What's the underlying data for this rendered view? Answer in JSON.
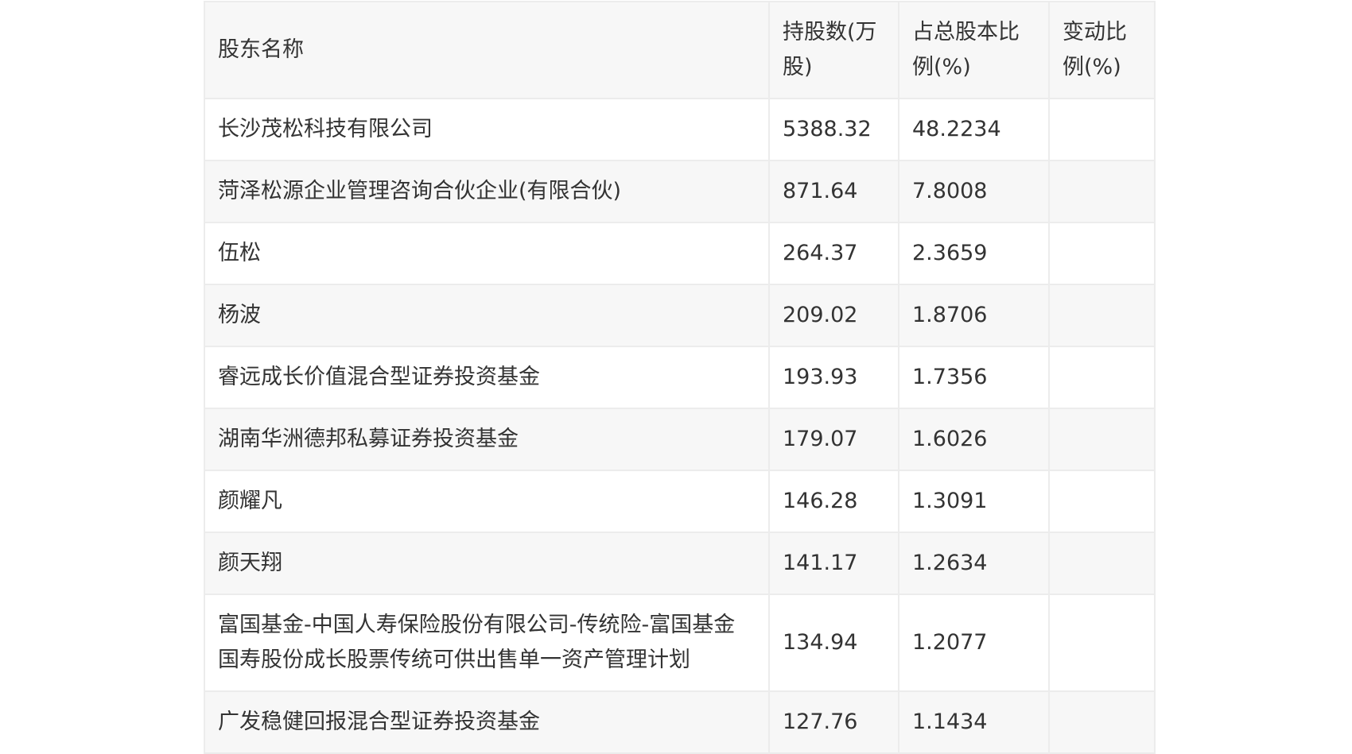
{
  "table": {
    "headers": {
      "name": "股东名称",
      "shares": "持股数(万股)",
      "ratio": "占总股本比例(%)",
      "change": "变动比例(%)"
    },
    "rows": [
      {
        "name": "长沙茂松科技有限公司",
        "shares": "5388.32",
        "ratio": "48.2234",
        "change": ""
      },
      {
        "name": "菏泽松源企业管理咨询合伙企业(有限合伙)",
        "shares": "871.64",
        "ratio": "7.8008",
        "change": ""
      },
      {
        "name": "伍松",
        "shares": "264.37",
        "ratio": "2.3659",
        "change": ""
      },
      {
        "name": "杨波",
        "shares": "209.02",
        "ratio": "1.8706",
        "change": ""
      },
      {
        "name": "睿远成长价值混合型证券投资基金",
        "shares": "193.93",
        "ratio": "1.7356",
        "change": ""
      },
      {
        "name": "湖南华洲德邦私募证券投资基金",
        "shares": "179.07",
        "ratio": "1.6026",
        "change": ""
      },
      {
        "name": "颜耀凡",
        "shares": "146.28",
        "ratio": "1.3091",
        "change": ""
      },
      {
        "name": "颜天翔",
        "shares": "141.17",
        "ratio": "1.2634",
        "change": ""
      },
      {
        "name": "富国基金-中国人寿保险股份有限公司-传统险-富国基金国寿股份成长股票传统可供出售单一资产管理计划",
        "shares": "134.94",
        "ratio": "1.2077",
        "change": ""
      },
      {
        "name": "广发稳健回报混合型证券投资基金",
        "shares": "127.76",
        "ratio": "1.1434",
        "change": ""
      }
    ]
  }
}
